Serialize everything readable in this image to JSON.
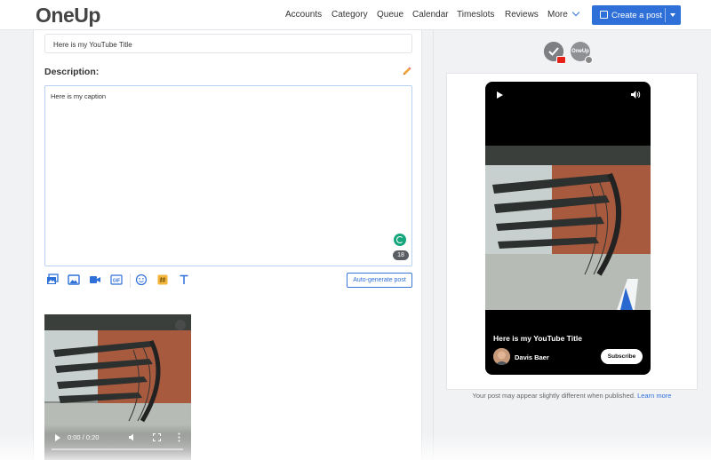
{
  "app": {
    "logo_text": "OneUp"
  },
  "nav": {
    "items": [
      "Accounts",
      "Category",
      "Queue",
      "Calendar",
      "Timeslots",
      "Reviews"
    ],
    "more_label": "More",
    "create_label": "Create a post"
  },
  "editor": {
    "title_value": "Here is my YouTube Title",
    "description_label": "Description:",
    "caption_value": "Here is my caption",
    "char_count": "18",
    "autogen_label": "Auto-generate post",
    "toolbar_icons": [
      "media-library-icon",
      "image-icon",
      "video-icon",
      "gif-icon",
      "emoji-icon",
      "hashtag-icon",
      "text-format-icon"
    ],
    "video": {
      "time": "0:00 / 0:20"
    }
  },
  "preview": {
    "accounts": [
      {
        "name": "youtube-account",
        "badge": "youtube"
      },
      {
        "name": "oneup-account",
        "label": "OneUp",
        "badge": "instagram"
      }
    ],
    "video_title": "Here is my YouTube Title",
    "channel_name": "Davis Baer",
    "subscribe_label": "Subscribe",
    "disclaimer": "Your post may appear slightly different when published.",
    "learn_more": "Learn more"
  },
  "colors": {
    "accent": "#2f6fd8",
    "grammarly": "#15a67c",
    "youtube_red": "#e62117"
  }
}
